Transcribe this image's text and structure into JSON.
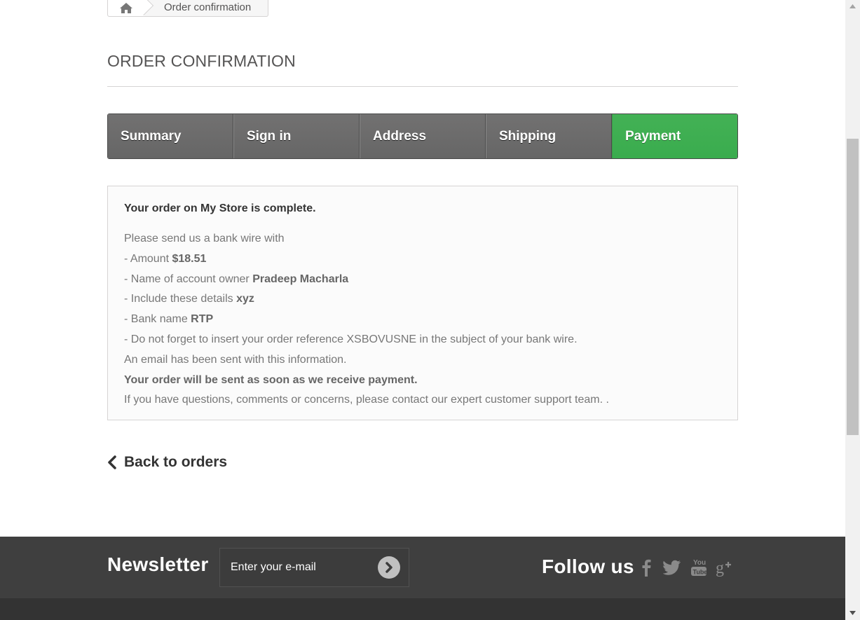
{
  "breadcrumb": {
    "home_icon": "home-icon",
    "current": "Order confirmation"
  },
  "page_title": "Order confirmation",
  "steps": [
    {
      "label": "Summary",
      "active": false
    },
    {
      "label": "Sign in",
      "active": false
    },
    {
      "label": "Address",
      "active": false
    },
    {
      "label": "Shipping",
      "active": false
    },
    {
      "label": "Payment",
      "active": true
    }
  ],
  "confirmation": {
    "complete_text": "Your order on My Store is complete.",
    "intro": "Please send us a bank wire with",
    "amount_label": "- Amount ",
    "amount_value": "$18.51",
    "owner_label": "- Name of account owner ",
    "owner_value": "Pradeep Macharla",
    "details_label": "- Include these details ",
    "details_value": "xyz",
    "bank_label": "- Bank name ",
    "bank_value": "RTP",
    "reference_line": "- Do not forget to insert your order reference XSBOVUSNE in the subject of your bank wire.",
    "email_line": "An email has been sent with this information.",
    "shipping_line": "Your order will be sent as soon as we receive payment.",
    "support_line": "If you have questions, comments or concerns, please contact our expert customer support team. ."
  },
  "back_link": "Back to orders",
  "footer": {
    "newsletter_title": "Newsletter",
    "newsletter_placeholder": "Enter your e-mail",
    "follow_title": "Follow us",
    "social_icons": [
      "facebook-icon",
      "twitter-icon",
      "youtube-icon",
      "google-plus-icon"
    ]
  },
  "colors": {
    "active_step": "#3aac4e",
    "inactive_step": "#6f6f6f",
    "footer": "#3f3f3f"
  }
}
